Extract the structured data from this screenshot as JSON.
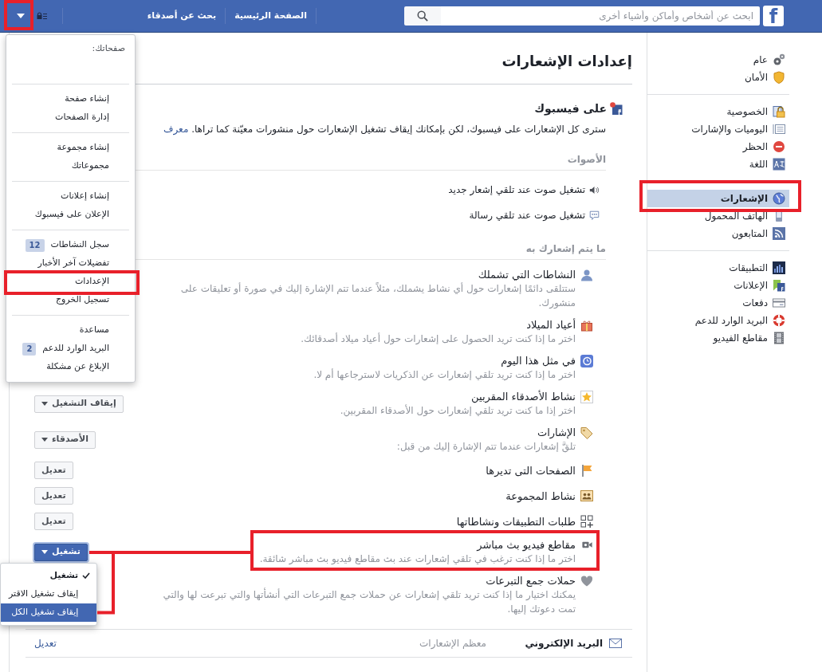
{
  "top_bar": {
    "logo_text": "f",
    "search": {
      "placeholder": "ابحث عن أشخاص وأماكن وأشياء أخرى"
    },
    "nav_links": [
      "الصفحة الرئيسية",
      "بحث عن أصدقاء"
    ],
    "menu_button": {
      "expanded": true,
      "annotated": true
    }
  },
  "account_menu": {
    "heading": "صفحاتك:",
    "groups": [
      {
        "items": [
          {
            "label": "إنشاء صفحة",
            "annotated": false
          },
          {
            "label": "إدارة الصفحات",
            "annotated": false
          }
        ]
      },
      {
        "items": [
          {
            "label": "إنشاء مجموعة",
            "annotated": false
          },
          {
            "label": "مجموعاتك",
            "annotated": false
          }
        ]
      },
      {
        "items": [
          {
            "label": "إنشاء إعلانات",
            "annotated": false
          },
          {
            "label": "الإعلان على فيسبوك",
            "annotated": false
          }
        ]
      },
      {
        "items": [
          {
            "label": "سجل النشاطات",
            "badge": "12",
            "annotated": false
          },
          {
            "label": "تفضيلات آخر الأخبار",
            "annotated": false
          },
          {
            "label": "الإعدادات",
            "annotated": true
          },
          {
            "label": "تسجيل الخروج",
            "annotated": false
          }
        ]
      },
      {
        "items": [
          {
            "label": "مساعدة",
            "annotated": false
          },
          {
            "label": "البريد الوارد للدعم",
            "badge": "2",
            "annotated": false
          },
          {
            "label": "الإبلاغ عن مشكلة",
            "annotated": false
          }
        ]
      }
    ]
  },
  "sidebar": {
    "groups": [
      {
        "items": [
          {
            "kind": "general",
            "label": "عام",
            "selected": false,
            "annotated": false
          },
          {
            "kind": "security",
            "label": "الأمان",
            "selected": false,
            "annotated": false
          }
        ]
      },
      {
        "items": [
          {
            "kind": "privacy",
            "label": "الخصوصية",
            "selected": false,
            "annotated": false
          },
          {
            "kind": "timeline",
            "label": "اليوميات والإشارات",
            "selected": false,
            "annotated": false
          },
          {
            "kind": "blocking",
            "label": "الحظر",
            "selected": false,
            "annotated": false
          },
          {
            "kind": "language",
            "label": "اللغة",
            "selected": false,
            "annotated": false
          }
        ]
      },
      {
        "items": [
          {
            "kind": "notifications",
            "label": "الإشعارات",
            "selected": true,
            "annotated": true
          },
          {
            "kind": "mobile",
            "label": "الهاتف المحمول",
            "selected": false,
            "annotated": false
          },
          {
            "kind": "followers",
            "label": "المتابعون",
            "selected": false,
            "annotated": false
          }
        ]
      },
      {
        "items": [
          {
            "kind": "apps",
            "label": "التطبيقات",
            "selected": false,
            "annotated": false
          },
          {
            "kind": "ads",
            "label": "الإعلانات",
            "selected": false,
            "annotated": false
          },
          {
            "kind": "payments",
            "label": "دفعات",
            "selected": false,
            "annotated": false
          },
          {
            "kind": "support",
            "label": "البريد الوارد للدعم",
            "selected": false,
            "annotated": false
          },
          {
            "kind": "videos",
            "label": "مقاطع الفيديو",
            "selected": false,
            "annotated": false
          }
        ]
      }
    ]
  },
  "settings": {
    "title": "إعدادات الإشعارات",
    "on_facebook": {
      "heading": "على فيسبوك",
      "description": "سترى كل الإشعارات على فيسبوك، لكن بإمكانك إيقاف تشغيل الإشعارات حول منشورات معيّنة كما تراها.",
      "link": "معرف"
    },
    "sounds": {
      "heading": "الأصوات",
      "items": [
        {
          "kind": "notification",
          "label": "تشغيل صوت عند تلقي إشعار جديد"
        },
        {
          "kind": "message",
          "label": "تشغيل صوت عند تلقي رسالة"
        }
      ]
    },
    "notify_about": {
      "heading": "ما يتم إشعارك به",
      "rows": [
        {
          "kind": "you",
          "title": "النشاطات التي تشملك",
          "description": "ستتلقى دائمًا إشعارات حول أي نشاط يشملك، مثلاً عندما تتم الإشارة إليك في صورة أو تعليقات على منشورك.",
          "annotated": false
        },
        {
          "kind": "birthdays",
          "title": "أعياد الميلاد",
          "description": "اختر ما إذا كنت تريد الحصول على إشعارات حول أعياد ميلاد أصدقائك.",
          "annotated": false
        },
        {
          "kind": "memories",
          "title": "في مثل هذا اليوم",
          "description": "اختر ما إذا كنت تريد تلقي إشعارات عن الذكريات لاسترجاعها أم لا.",
          "annotated": false
        },
        {
          "kind": "friends",
          "title": "نشاط الأصدقاء المقربين",
          "description": "اختر إذا ما كنت تريد تلقي إشعارات حول الأصدقاء المقربين.",
          "annotated": false,
          "control": {
            "kind": "dropdown",
            "label": "إيقاف التشغيل",
            "expanded": false
          }
        },
        {
          "kind": "tags",
          "title": "الإشارات",
          "description": "تلقَّ إشعارات عندما تتم الإشارة إليك من قبل:",
          "annotated": false,
          "control": {
            "kind": "dropdown",
            "label": "الأصدقاء",
            "expanded": false
          }
        },
        {
          "kind": "pages",
          "title": "الصفحات التى تديرها",
          "annotated": false,
          "control": {
            "kind": "button",
            "label": "تعديل"
          }
        },
        {
          "kind": "groups",
          "title": "نشاط المجموعة",
          "annotated": false,
          "control": {
            "kind": "button",
            "label": "تعديل"
          }
        },
        {
          "kind": "apps",
          "title": "طلبات التطبيقات ونشاطاتها",
          "annotated": false,
          "control": {
            "kind": "button",
            "label": "تعديل"
          }
        },
        {
          "kind": "live",
          "title": "مقاطع فيديو بث مباشر",
          "description": "اختر ما إذا كنت ترغب في تلقي إشعارات عند بث مقاطع فيديو بث مباشر شائقة.",
          "annotated": true,
          "control": {
            "kind": "dropdown",
            "label": "تشغيل",
            "expanded": true,
            "options": [
              {
                "label": "تشغيل",
                "selected": true,
                "highlighted": false
              },
              {
                "label": "إيقاف تشغيل الاقتر",
                "selected": false,
                "highlighted": false
              },
              {
                "label": "إيقاف تشغيل الكل",
                "selected": false,
                "highlighted": true
              }
            ]
          }
        },
        {
          "kind": "fundraisers",
          "title": "حملات جمع التبرعات",
          "description": "يمكنك اختيار ما إذا كنت تريد تلقي إشعارات عن حملات جمع التبرعات التي أنشأتها والتي تبرعت لها والتي تمت دعوتك إليها.",
          "annotated": false
        }
      ]
    },
    "email": {
      "label": "البريد الإلكتروني",
      "value": "معظم الإشعارات",
      "link": "تعديل"
    }
  }
}
